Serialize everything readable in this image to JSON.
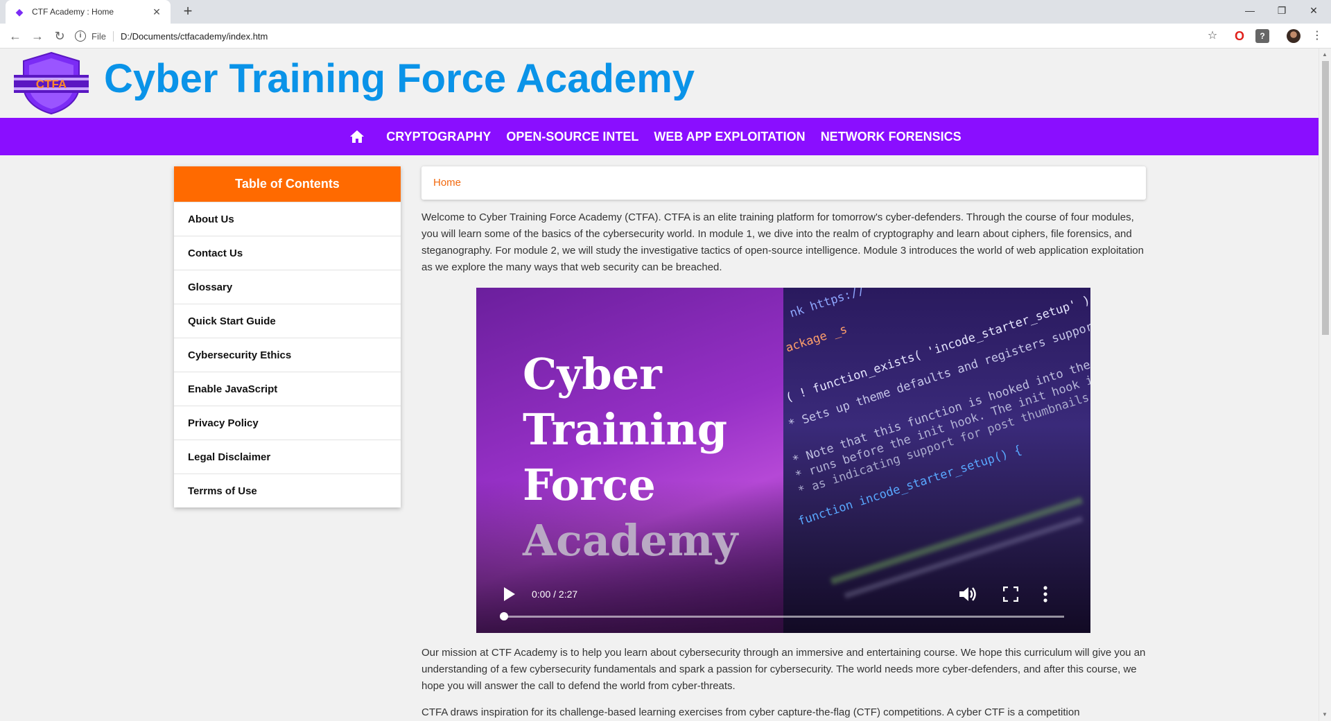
{
  "browser": {
    "tab_title": "CTF Academy : Home",
    "scheme_label": "File",
    "url": "D:/Documents/ctfacademy/index.htm"
  },
  "site": {
    "logo_text": "CTFA",
    "title": "Cyber Training Force Academy"
  },
  "nav": {
    "links": [
      "CRYPTOGRAPHY",
      "OPEN-SOURCE INTEL",
      "WEB APP EXPLOITATION",
      "NETWORK FORENSICS"
    ]
  },
  "toc": {
    "header": "Table of Contents",
    "items": [
      "About Us",
      "Contact Us",
      "Glossary",
      "Quick Start Guide",
      "Cybersecurity Ethics",
      "Enable JavaScript",
      "Privacy Policy",
      "Legal Disclaimer",
      "Terrms of Use"
    ]
  },
  "breadcrumb": "Home",
  "content": {
    "intro": "Welcome to Cyber Training Force Academy (CTFA). CTFA is an elite training platform for tomorrow's cyber-defenders. Through the course of four modules, you will learn some of the basics of the cybersecurity world. In module 1, we dive into the realm of cryptography and learn about ciphers, file forensics, and steganography. For module 2, we will study the investigative tactics of open-source intelligence. Module 3 introduces the world of web application exploitation as we explore the many ways that web security can be breached.",
    "mission": "Our mission at CTF Academy is to help you learn about cybersecurity through an immersive and entertaining course. We hope this curriculum will give you an understanding of a few cybersecurity fundamentals and spark a passion for cybersecurity. The world needs more cyber-defenders, and after this course, we hope you will answer the call to defend the world from cyber-threats.",
    "inspiration": "CTFA draws inspiration for its challenge-based learning exercises from cyber capture-the-flag (CTF) competitions. A cyber CTF is a competition"
  },
  "video": {
    "title_lines": [
      "Cyber",
      "Training",
      "Force",
      "Academy"
    ],
    "time": "0:00 / 2:27",
    "progress_fraction": 0.0,
    "code_lines": [
      "nk https://",
      "ackage _s",
      "( ! function_exists( 'incode_starter_setup' ) ) :",
      "* Sets up theme defaults and registers support for va",
      "* Note that this function is hooked into the after_se",
      "* runs before the init hook. The init hook is too late",
      "* as indicating support for post thumbnails.",
      "function incode_starter_setup() {"
    ]
  },
  "colors": {
    "brand_blue": "#0a93e8",
    "nav_purple": "#8a0eff",
    "toc_orange": "#ff6a00",
    "breadcrumb_orange": "#f2680d"
  }
}
